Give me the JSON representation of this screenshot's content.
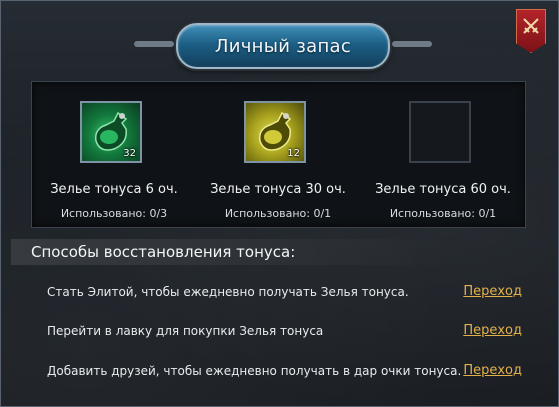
{
  "window": {
    "title": "Личный запас"
  },
  "close_icon": "crossed-swords-icon",
  "items": [
    {
      "name": "Зелье тонуса 6 оч.",
      "used": "Использовано: 0/3",
      "count": "32",
      "color": "#1fa053",
      "icon": "potion-flask-icon"
    },
    {
      "name": "Зелье тонуса 30 оч.",
      "used": "Использовано: 0/1",
      "count": "12",
      "color": "#c9c22a",
      "icon": "potion-flask-icon"
    },
    {
      "name": "Зелье тонуса 60 оч.",
      "used": "Использовано: 0/1",
      "count": "",
      "color": "",
      "icon": ""
    }
  ],
  "ways": {
    "header": "Способы восстановления тонуса:",
    "rows": [
      {
        "text": "Стать Элитой, чтобы ежедневно получать Зелья тонуса.",
        "link": "Переход"
      },
      {
        "text": "Перейти в лавку для покупки Зелья тонуса",
        "link": "Переход"
      },
      {
        "text": "Добавить друзей, чтобы ежедневно получать в дар очки тонуса.",
        "link": "Переход"
      }
    ]
  },
  "colors": {
    "link": "#e2b14a",
    "title_plate": "#1d5f86",
    "close_button": "#a01e24"
  }
}
